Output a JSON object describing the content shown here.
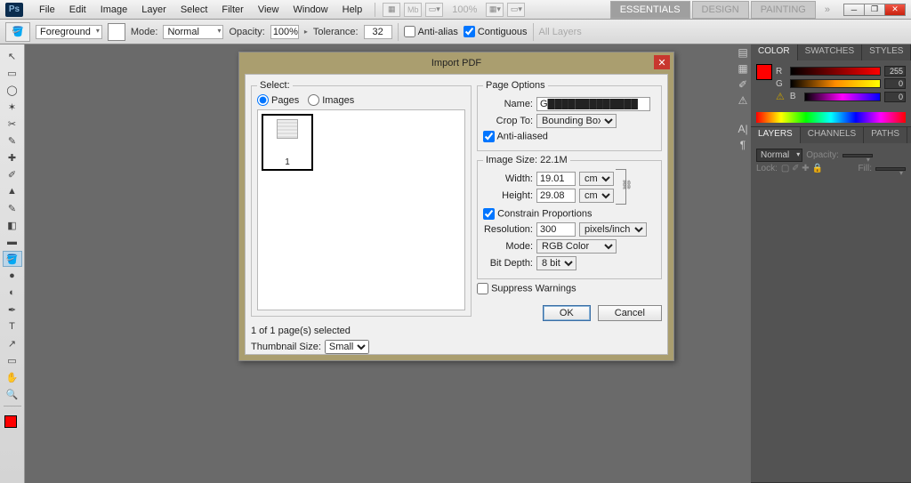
{
  "menu": {
    "items": [
      "File",
      "Edit",
      "Image",
      "Layer",
      "Select",
      "Filter",
      "View",
      "Window",
      "Help"
    ],
    "zoom": "100%"
  },
  "workspaces": {
    "essentials": "ESSENTIALS",
    "design": "DESIGN",
    "painting": "PAINTING"
  },
  "optbar": {
    "foreground": "Foreground",
    "mode_lbl": "Mode:",
    "mode_val": "Normal",
    "opacity_lbl": "Opacity:",
    "opacity_val": "100%",
    "tolerance_lbl": "Tolerance:",
    "tolerance_val": "32",
    "antialias": "Anti-alias",
    "contiguous": "Contiguous",
    "alllayers": "All Layers"
  },
  "tools": [
    "↖",
    "▭",
    "◌",
    "✂",
    "✎",
    "✐",
    "⌖",
    "✏",
    "✦",
    "●",
    "▲",
    "⬚",
    "◐",
    "✥",
    "✎",
    "◧",
    "◌",
    "●",
    "T",
    "↗",
    "▭",
    "✋",
    "🔍"
  ],
  "color_panel": {
    "tabs": [
      "COLOR",
      "SWATCHES",
      "STYLES"
    ],
    "r_lbl": "R",
    "g_lbl": "G",
    "b_lbl": "B",
    "r": "255",
    "g": "0",
    "b": "0"
  },
  "layers_panel": {
    "tabs": [
      "LAYERS",
      "CHANNELS",
      "PATHS"
    ],
    "blend": "Normal",
    "opacity_lbl": "Opacity:",
    "lock_lbl": "Lock:",
    "fill_lbl": "Fill:"
  },
  "dialog": {
    "title": "Import PDF",
    "select_legend": "Select:",
    "radio_pages": "Pages",
    "radio_images": "Images",
    "thumb_page": "1",
    "status": "1 of 1 page(s) selected",
    "thumb_size_lbl": "Thumbnail Size:",
    "thumb_size_val": "Small",
    "page_options_legend": "Page Options",
    "name_lbl": "Name:",
    "name_val": "G█████████████",
    "crop_lbl": "Crop To:",
    "crop_val": "Bounding Box",
    "antialiased": "Anti-aliased",
    "imgsize_legend": "Image Size: 22.1M",
    "width_lbl": "Width:",
    "width_val": "19.01",
    "width_unit": "cm",
    "height_lbl": "Height:",
    "height_val": "29.08",
    "height_unit": "cm",
    "constrain": "Constrain Proportions",
    "res_lbl": "Resolution:",
    "res_val": "300",
    "res_unit": "pixels/inch",
    "mode_lbl": "Mode:",
    "mode_val": "RGB Color",
    "bit_lbl": "Bit Depth:",
    "bit_val": "8 bit",
    "suppress": "Suppress Warnings",
    "ok": "OK",
    "cancel": "Cancel"
  }
}
